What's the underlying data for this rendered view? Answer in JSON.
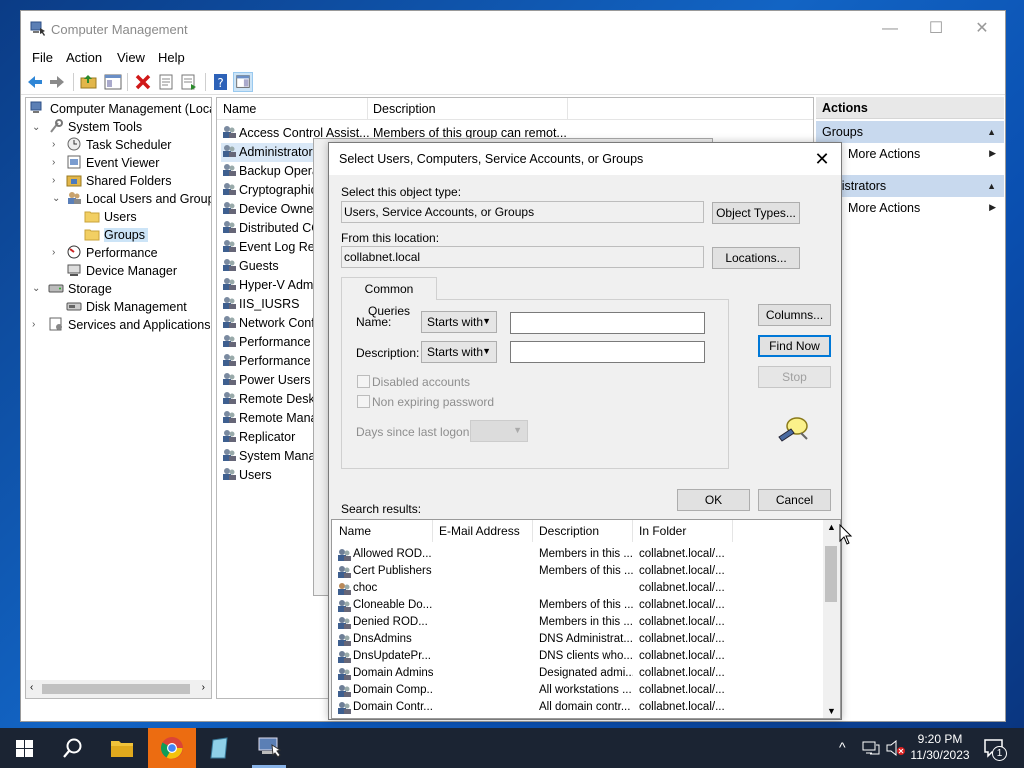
{
  "window": {
    "title": "Computer Management",
    "minimize": "—",
    "maximize": "☐",
    "close": "✕"
  },
  "menu": [
    "File",
    "Action",
    "View",
    "Help"
  ],
  "tree": [
    {
      "label": "Computer Management (Local",
      "icon": "computer-management-icon"
    },
    {
      "label": "System Tools",
      "icon": "system-tools-icon"
    },
    {
      "label": "Task Scheduler",
      "icon": "clock-icon"
    },
    {
      "label": "Event Viewer",
      "icon": "event-viewer-icon"
    },
    {
      "label": "Shared Folders",
      "icon": "shared-folder-icon"
    },
    {
      "label": "Local Users and Groups",
      "icon": "users-groups-icon"
    },
    {
      "label": "Users",
      "icon": "folder-icon"
    },
    {
      "label": "Groups",
      "icon": "folder-icon"
    },
    {
      "label": "Performance",
      "icon": "performance-icon"
    },
    {
      "label": "Device Manager",
      "icon": "device-manager-icon"
    },
    {
      "label": "Storage",
      "icon": "storage-icon"
    },
    {
      "label": "Disk Management",
      "icon": "disk-icon"
    },
    {
      "label": "Services and Applications",
      "icon": "services-icon"
    }
  ],
  "list": {
    "columns": [
      "Name",
      "Description"
    ],
    "rows": [
      {
        "name": "Access Control Assist...",
        "desc": "Members of this group can remot..."
      },
      {
        "name": "Administrators",
        "desc": ""
      },
      {
        "name": "Backup Operat",
        "desc": ""
      },
      {
        "name": "Cryptographic",
        "desc": ""
      },
      {
        "name": "Device Owners",
        "desc": ""
      },
      {
        "name": "Distributed CO",
        "desc": ""
      },
      {
        "name": "Event Log Rea",
        "desc": ""
      },
      {
        "name": "Guests",
        "desc": ""
      },
      {
        "name": "Hyper-V Admi",
        "desc": ""
      },
      {
        "name": "IIS_IUSRS",
        "desc": ""
      },
      {
        "name": "Network Confi",
        "desc": ""
      },
      {
        "name": "Performance L",
        "desc": ""
      },
      {
        "name": "Performance M",
        "desc": ""
      },
      {
        "name": "Power Users",
        "desc": ""
      },
      {
        "name": "Remote Deskto",
        "desc": ""
      },
      {
        "name": "Remote Mana",
        "desc": ""
      },
      {
        "name": "Replicator",
        "desc": ""
      },
      {
        "name": "System Manag",
        "desc": ""
      },
      {
        "name": "Users",
        "desc": ""
      }
    ]
  },
  "actions": {
    "header": "Actions",
    "group1": "Groups",
    "more1": "More Actions",
    "group2": "inistrators",
    "more2": "More Actions"
  },
  "dialog": {
    "title": "Select Users, Computers, Service Accounts, or Groups",
    "object_type_label": "Select this object type:",
    "object_type_value": "Users, Service Accounts, or Groups",
    "object_types_btn": "Object Types...",
    "location_label": "From this location:",
    "location_value": "collabnet.local",
    "locations_btn": "Locations...",
    "tab": "Common Queries",
    "name_label": "Name:",
    "name_mode": "Starts with",
    "desc_label": "Description:",
    "desc_mode": "Starts with",
    "disabled_accounts": "Disabled accounts",
    "non_expiring": "Non expiring password",
    "days_label": "Days since last logon:",
    "columns_btn": "Columns...",
    "find_btn": "Find Now",
    "stop_btn": "Stop",
    "ok_btn": "OK",
    "cancel_btn": "Cancel",
    "results_label": "Search results:",
    "results_columns": [
      "Name",
      "E-Mail Address",
      "Description",
      "In Folder"
    ],
    "results": [
      {
        "name": "Allowed ROD...",
        "email": "",
        "desc": "Members in this ...",
        "folder": "collabnet.local/..."
      },
      {
        "name": "Cert Publishers",
        "email": "",
        "desc": "Members of this ...",
        "folder": "collabnet.local/..."
      },
      {
        "name": "choc",
        "email": "",
        "desc": "",
        "folder": "collabnet.local/..."
      },
      {
        "name": "Cloneable Do...",
        "email": "",
        "desc": "Members of this ...",
        "folder": "collabnet.local/..."
      },
      {
        "name": "Denied ROD...",
        "email": "",
        "desc": "Members in this ...",
        "folder": "collabnet.local/..."
      },
      {
        "name": "DnsAdmins",
        "email": "",
        "desc": "DNS Administrat...",
        "folder": "collabnet.local/..."
      },
      {
        "name": "DnsUpdatePr...",
        "email": "",
        "desc": "DNS clients who...",
        "folder": "collabnet.local/..."
      },
      {
        "name": "Domain Admins",
        "email": "",
        "desc": "Designated admi...",
        "folder": "collabnet.local/..."
      },
      {
        "name": "Domain Comp...",
        "email": "",
        "desc": "All workstations ...",
        "folder": "collabnet.local/..."
      },
      {
        "name": "Domain Contr...",
        "email": "",
        "desc": "All domain contr...",
        "folder": "collabnet.local/..."
      }
    ]
  },
  "taskbar": {
    "time": "9:20 PM",
    "date": "11/30/2023",
    "notification_count": "1"
  },
  "colors": {
    "selection": "#cce4f7",
    "accent": "#0078d7",
    "taskbar": "#1b2433",
    "chrome_active": "#ec6c11"
  }
}
